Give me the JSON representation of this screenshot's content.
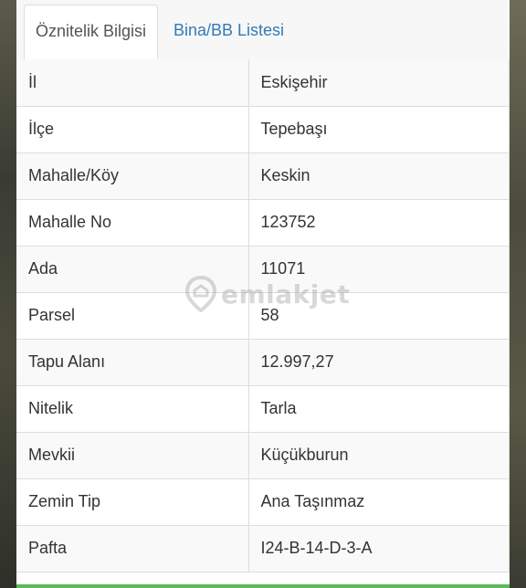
{
  "tabs": [
    {
      "label": "Öznitelik Bilgisi",
      "active": true
    },
    {
      "label": "Bina/BB Listesi",
      "active": false
    }
  ],
  "rows": [
    {
      "label": "İl",
      "value": "Eskişehir"
    },
    {
      "label": "İlçe",
      "value": "Tepebaşı"
    },
    {
      "label": "Mahalle/Köy",
      "value": "Keskin"
    },
    {
      "label": "Mahalle No",
      "value": "123752"
    },
    {
      "label": "Ada",
      "value": "11071"
    },
    {
      "label": "Parsel",
      "value": "58"
    },
    {
      "label": "Tapu Alanı",
      "value": "12.997,27"
    },
    {
      "label": "Nitelik",
      "value": "Tarla"
    },
    {
      "label": "Mevkii",
      "value": "Küçükburun"
    },
    {
      "label": "Zemin Tip",
      "value": "Ana Taşınmaz"
    },
    {
      "label": "Pafta",
      "value": "I24-B-14-D-3-A"
    }
  ],
  "watermark": {
    "text": "emlakjet",
    "icon": "location-pin-icon"
  },
  "colors": {
    "link": "#337ab7",
    "accent": "#5cb85c",
    "border": "#dddddd"
  }
}
